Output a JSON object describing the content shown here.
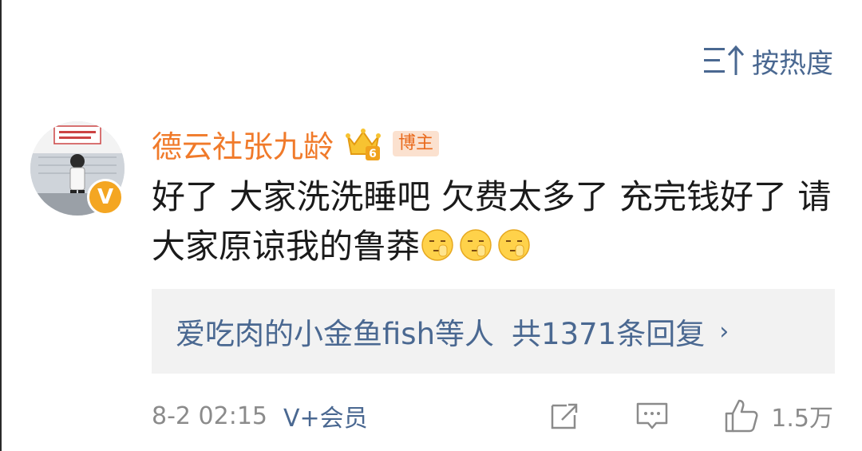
{
  "sort": {
    "label": "按热度",
    "icon": "sort-icon"
  },
  "comment": {
    "author": "德云社张九龄",
    "blogger_tag": "博主",
    "crown_level": "6",
    "verified_mark": "V",
    "text": "好了 大家洗洗睡吧 欠费太多了 充完钱好了 请大家原谅我的鲁莽",
    "emojis": [
      "shh-face-emoji",
      "shh-face-emoji",
      "shh-face-emoji"
    ],
    "replies": {
      "summary": "爱吃肉的小金鱼fish等人",
      "count_text": "共1371条回复"
    },
    "timestamp": "8-2 02:15",
    "member": "V+会员",
    "likes": "1.5万"
  },
  "colors": {
    "link": "#4a6891",
    "author": "#f07a2a",
    "muted": "#8b8b8b"
  }
}
